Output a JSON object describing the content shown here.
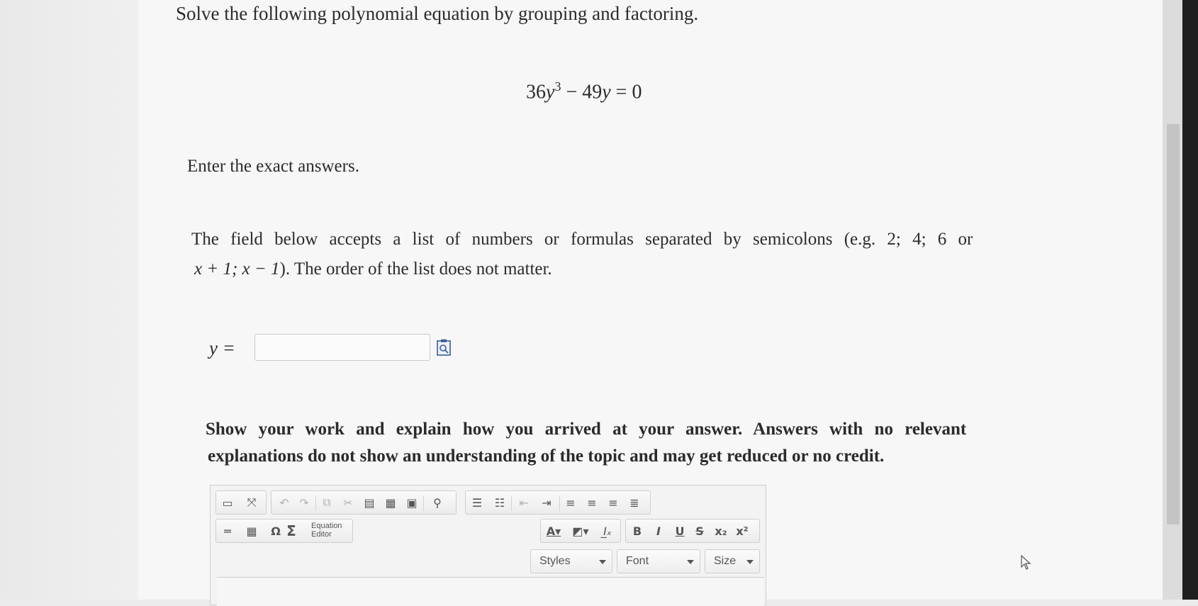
{
  "question": {
    "title": "Solve the following polynomial equation by grouping and factoring.",
    "equation": {
      "coef1": "36",
      "var": "y",
      "exp": "3",
      "minus": " − ",
      "coef2": "49",
      "var2": "y",
      "rhs": " = 0"
    },
    "instruction": "Enter the exact answers.",
    "format_line1_a": "The field below accepts a list of numbers or formulas separated by semicolons (e.g. 2; 4; 6 or",
    "format_line2_math": "x + 1; x − 1",
    "format_line2_rest": "). The order of the list does not matter.",
    "answer_label": "y =",
    "answer_value": "",
    "work_line1": "Show your work and explain how you arrived at your answer. Answers with no relevant",
    "work_line2": "explanations do not show an understanding of the topic and may get reduced or no credit."
  },
  "editor": {
    "equation_editor_label": "Equation Editor",
    "styles_label": "Styles",
    "font_label": "Font",
    "size_label": "Size",
    "icons": [
      "source-icon",
      "maximize-icon",
      "undo-icon",
      "redo-icon",
      "copy-icon",
      "cut-icon",
      "paste-icon",
      "paste-text-icon",
      "paste-word-icon",
      "find-icon",
      "numbered-list-icon",
      "bulleted-list-icon",
      "outdent-icon",
      "indent-icon",
      "align-left-icon",
      "align-center-icon",
      "align-right-icon",
      "justify-icon",
      "horizontal-rule-icon",
      "table-icon",
      "special-char-icon",
      "sigma-icon",
      "text-color-icon",
      "background-color-icon",
      "remove-format-icon",
      "bold-icon",
      "italic-icon",
      "underline-icon",
      "strike-icon",
      "subscript-icon",
      "superscript-icon"
    ]
  }
}
